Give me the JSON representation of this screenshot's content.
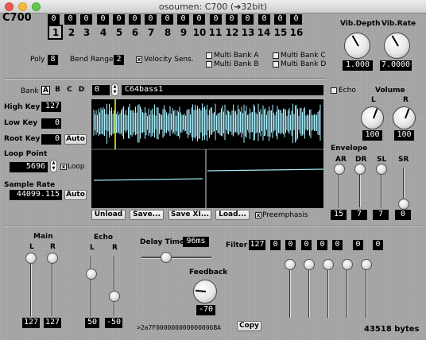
{
  "window": {
    "title": "osoumen: C700 (➜32bit)"
  },
  "app": {
    "logo": "C700"
  },
  "channels": {
    "values": [
      "0",
      "0",
      "0",
      "0",
      "0",
      "0",
      "0",
      "0",
      "0",
      "0",
      "0",
      "0",
      "0",
      "0",
      "0",
      "0"
    ],
    "labels": [
      "1",
      "2",
      "3",
      "4",
      "5",
      "6",
      "7",
      "8",
      "9",
      "10",
      "11",
      "12",
      "13",
      "14",
      "15",
      "16"
    ],
    "selected": "1"
  },
  "vibrato": {
    "depth_label": "Vib.Depth",
    "depth_value": "1.000",
    "rate_label": "Vib.Rate",
    "rate_value": "7.0000"
  },
  "poly": {
    "label": "Poly",
    "value": "8"
  },
  "bend": {
    "label": "Bend Range",
    "value": "2"
  },
  "velocity": {
    "label": "Velocity Sens.",
    "checked": true
  },
  "multibank": {
    "a": "Multi Bank A",
    "b": "Multi Bank B",
    "c": "Multi Bank C",
    "d": "Multi Bank D"
  },
  "bank": {
    "label": "Bank",
    "options": [
      "A",
      "B",
      "C",
      "D"
    ],
    "selected": "A"
  },
  "program": {
    "number": "0",
    "name": "C64bass1"
  },
  "keys": {
    "high_label": "High Key",
    "high_value": "127",
    "low_label": "Low Key",
    "low_value": "0",
    "root_label": "Root Key",
    "root_value": "0",
    "auto_label": "Auto"
  },
  "loop": {
    "label": "Loop Point",
    "value": "5696",
    "check_label": "Loop",
    "checked": true
  },
  "sample_rate": {
    "label": "Sample Rate",
    "value": "44099.115",
    "auto_label": "Auto"
  },
  "actions": {
    "unload": "Unload",
    "save": "Save...",
    "save_xi": "Save XI...",
    "load": "Load...",
    "preemphasis": "Preemphasis",
    "preemphasis_checked": true
  },
  "echo_check": {
    "label": "Echo",
    "checked": false
  },
  "volume": {
    "label": "Volume",
    "l_label": "L",
    "r_label": "R",
    "l_value": "100",
    "r_value": "100"
  },
  "envelope": {
    "label": "Envelope",
    "params": [
      {
        "label": "AR",
        "value": "15",
        "level": 1.0
      },
      {
        "label": "DR",
        "value": "7",
        "level": 1.0
      },
      {
        "label": "SL",
        "value": "7",
        "level": 1.0
      },
      {
        "label": "SR",
        "value": "0",
        "level": 0.0
      }
    ]
  },
  "main": {
    "label": "Main",
    "l_label": "L",
    "r_label": "R",
    "l_value": "127",
    "r_value": "127"
  },
  "echo": {
    "label": "Echo",
    "l_label": "L",
    "r_label": "R",
    "l_value": "50",
    "r_value": "-50"
  },
  "delay": {
    "label": "Delay Time",
    "value": "96ms"
  },
  "feedback": {
    "label": "Feedback",
    "value": "-70"
  },
  "filter": {
    "label": "Filter",
    "values": [
      "127",
      "0",
      "0",
      "0",
      "0",
      "0",
      "0",
      "0"
    ]
  },
  "hex": {
    "value": ">2a7F000000000000006BA",
    "copy_label": "Copy"
  },
  "bytes": {
    "value": "43518 bytes"
  },
  "colors": {
    "lcd_bg": "#000000",
    "waveform": "#a8f0ff",
    "playhead": "#ffff00",
    "panel": "#a6a6a6"
  }
}
